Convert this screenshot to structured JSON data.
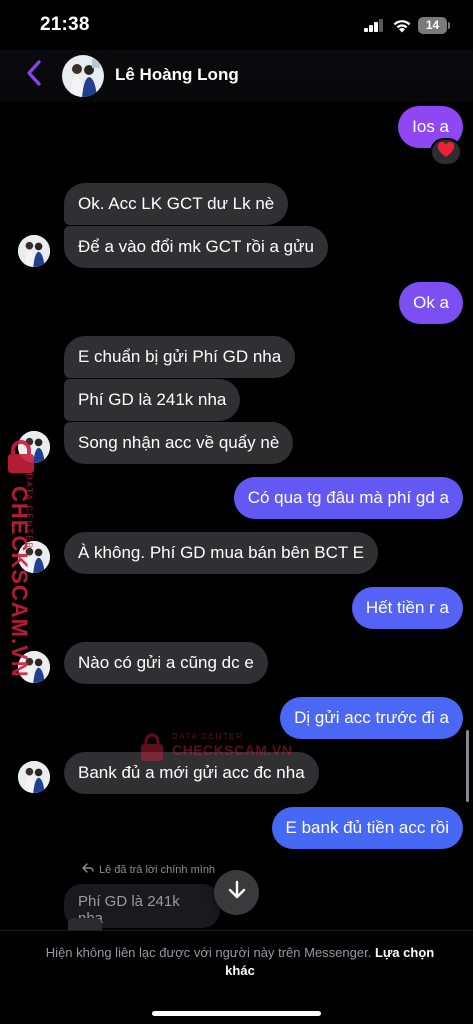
{
  "status_bar": {
    "time": "21:38",
    "battery": "14"
  },
  "header": {
    "contact_name": "Lê Hoàng Long"
  },
  "messages": [
    {
      "side": "out",
      "text": "Ios a",
      "reaction": "heart"
    },
    {
      "side": "in",
      "text": "Ok. Acc LK GCT dư Lk nè"
    },
    {
      "side": "in",
      "text": "Để a vào đổi mk GCT rồi a gửu"
    },
    {
      "side": "out",
      "text": "Ok a"
    },
    {
      "side": "in",
      "text": "E chuẩn bị gửi Phí GD nha"
    },
    {
      "side": "in",
      "text": "Phí GD là 241k nha"
    },
    {
      "side": "in",
      "text": "Song nhận acc về quẩy nè"
    },
    {
      "side": "out",
      "text": "Có qua tg đâu mà phí gd a"
    },
    {
      "side": "in",
      "text": "À không. Phí GD mua bán bên BCT E"
    },
    {
      "side": "out",
      "text": "Hết tiền r a"
    },
    {
      "side": "in",
      "text": "Nào có gửi a cũng dc e"
    },
    {
      "side": "out",
      "text": "Dị gửi acc trước đi a"
    },
    {
      "side": "in",
      "text": "Bank đủ a mới gửi acc đc nha"
    },
    {
      "side": "out",
      "text": "E bank đủ tiền acc rồi"
    }
  ],
  "reply": {
    "note": "Lê đã trả lời chính mình",
    "quote": "Phí GD là 241k nha"
  },
  "notice": {
    "text": "Hiện không liên lạc được với người này trên Messenger.",
    "link": "Lựa chọn khác"
  },
  "watermark": {
    "top_line": "DATA CENTER",
    "brand": "CHECKSCAM.VN"
  },
  "colors": {
    "accent_purple": "#8a43f0",
    "outgoing_top": "#8e47f2",
    "outgoing_bottom": "#4568f5",
    "incoming": "#303033",
    "background": "#000000"
  },
  "icons": {
    "back": "chevron-left-icon",
    "scroll": "arrow-down-icon",
    "reply": "reply-arrow-icon",
    "reaction": "heart-icon"
  }
}
